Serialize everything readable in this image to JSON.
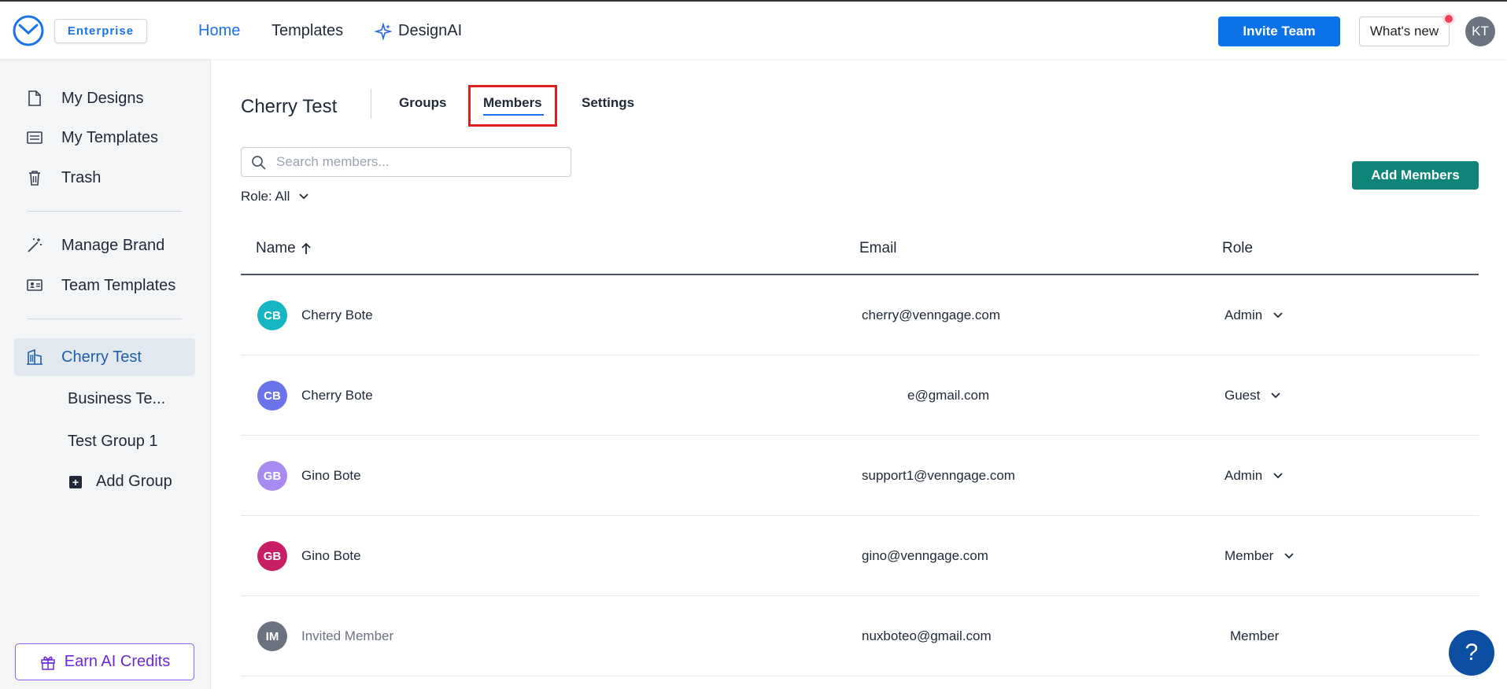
{
  "header": {
    "badge": "Enterprise",
    "nav": {
      "home": "Home",
      "templates": "Templates",
      "designai": "DesignAI"
    },
    "invite_label": "Invite Team",
    "whats_new_label": "What's new",
    "avatar_initials": "KT",
    "accent_color": "#0b72e7"
  },
  "sidebar": {
    "items": [
      {
        "label": "My Designs",
        "icon": "file-icon"
      },
      {
        "label": "My Templates",
        "icon": "templates-icon"
      },
      {
        "label": "Trash",
        "icon": "trash-icon"
      },
      {
        "label": "Manage Brand",
        "icon": "magic-wand-icon"
      },
      {
        "label": "Team Templates",
        "icon": "team-templates-icon"
      },
      {
        "label": "Cherry Test",
        "icon": "building-icon"
      }
    ],
    "groups": [
      "Business Te...",
      "Test Group 1"
    ],
    "add_group_label": "Add Group",
    "earn_credits_label": "Earn AI Credits"
  },
  "main": {
    "title": "Cherry Test",
    "tabs": {
      "groups": "Groups",
      "members": "Members",
      "settings": "Settings"
    },
    "search_placeholder": "Search members...",
    "role_filter": "Role: All",
    "add_members_label": "Add Members",
    "columns": {
      "name": "Name",
      "email": "Email",
      "role": "Role"
    },
    "rows": [
      {
        "initials": "CB",
        "name": "Cherry Bote",
        "email": "cherry@venngage.com",
        "role": "Admin",
        "avatar_color": "#16b5c4"
      },
      {
        "initials": "CB",
        "name": "Cherry Bote",
        "email": "e@gmail.com",
        "role": "Guest",
        "avatar_color": "#6a73ea"
      },
      {
        "initials": "GB",
        "name": "Gino Bote",
        "email": "support1@venngage.com",
        "role": "Admin",
        "avatar_color": "#a78bf0"
      },
      {
        "initials": "GB",
        "name": "Gino Bote",
        "email": "gino@venngage.com",
        "role": "Member",
        "avatar_color": "#c81e66"
      },
      {
        "initials": "IM",
        "name": "Invited Member",
        "email": "nuxboteo@gmail.com",
        "role": "Member",
        "avatar_color": "#6b7280"
      }
    ]
  },
  "help_label": "?"
}
